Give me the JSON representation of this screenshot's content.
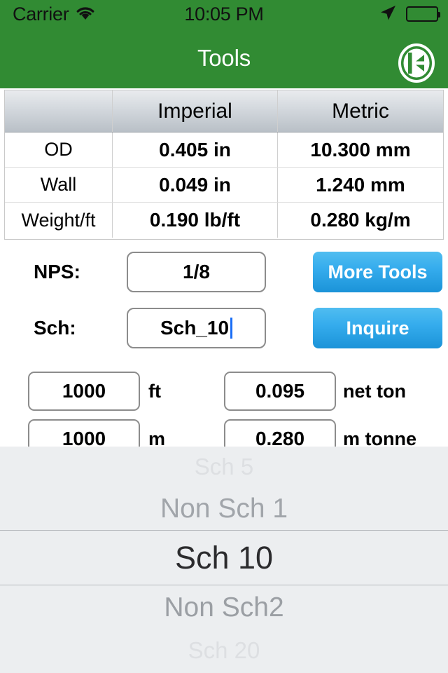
{
  "status_bar": {
    "carrier": "Carrier",
    "wifi_icon": "wifi-icon",
    "time": "10:05 PM",
    "location_icon": "location-arrow-icon",
    "battery_icon": "battery-full-icon"
  },
  "nav_bar": {
    "title": "Tools",
    "logo_icon": "company-logo-icon",
    "background_color": "#318b33"
  },
  "spec_table": {
    "headers": [
      "",
      "Imperial",
      "Metric"
    ],
    "rows": [
      {
        "label": "OD",
        "imperial": "0.405 in",
        "metric": "10.300 mm"
      },
      {
        "label": "Wall",
        "imperial": "0.049 in",
        "metric": "1.240 mm"
      },
      {
        "label": "Weight/ft",
        "imperial": "0.190 lb/ft",
        "metric": "0.280 kg/m"
      }
    ]
  },
  "form": {
    "nps": {
      "label": "NPS:",
      "value": "1/8"
    },
    "sch": {
      "label": "Sch:",
      "value": "Sch_10"
    },
    "more_tools_button": "More Tools",
    "inquire_button": "Inquire"
  },
  "conversions": [
    {
      "left_value": "1000",
      "left_unit": "ft",
      "right_value": "0.095",
      "right_unit": "net ton"
    },
    {
      "left_value": "1000",
      "left_unit": "m",
      "right_value": "0.280",
      "right_unit": "m tonne"
    }
  ],
  "picker": {
    "selected": "Sch 10",
    "items": [
      "Sch 5",
      "Non Sch 1",
      "Sch 10",
      "Non Sch2",
      "Sch 20"
    ],
    "background_color": "#eceef0"
  },
  "colors": {
    "brand_green": "#318b33",
    "button_blue": "#35aced",
    "caret_blue": "#1a6ef5"
  }
}
